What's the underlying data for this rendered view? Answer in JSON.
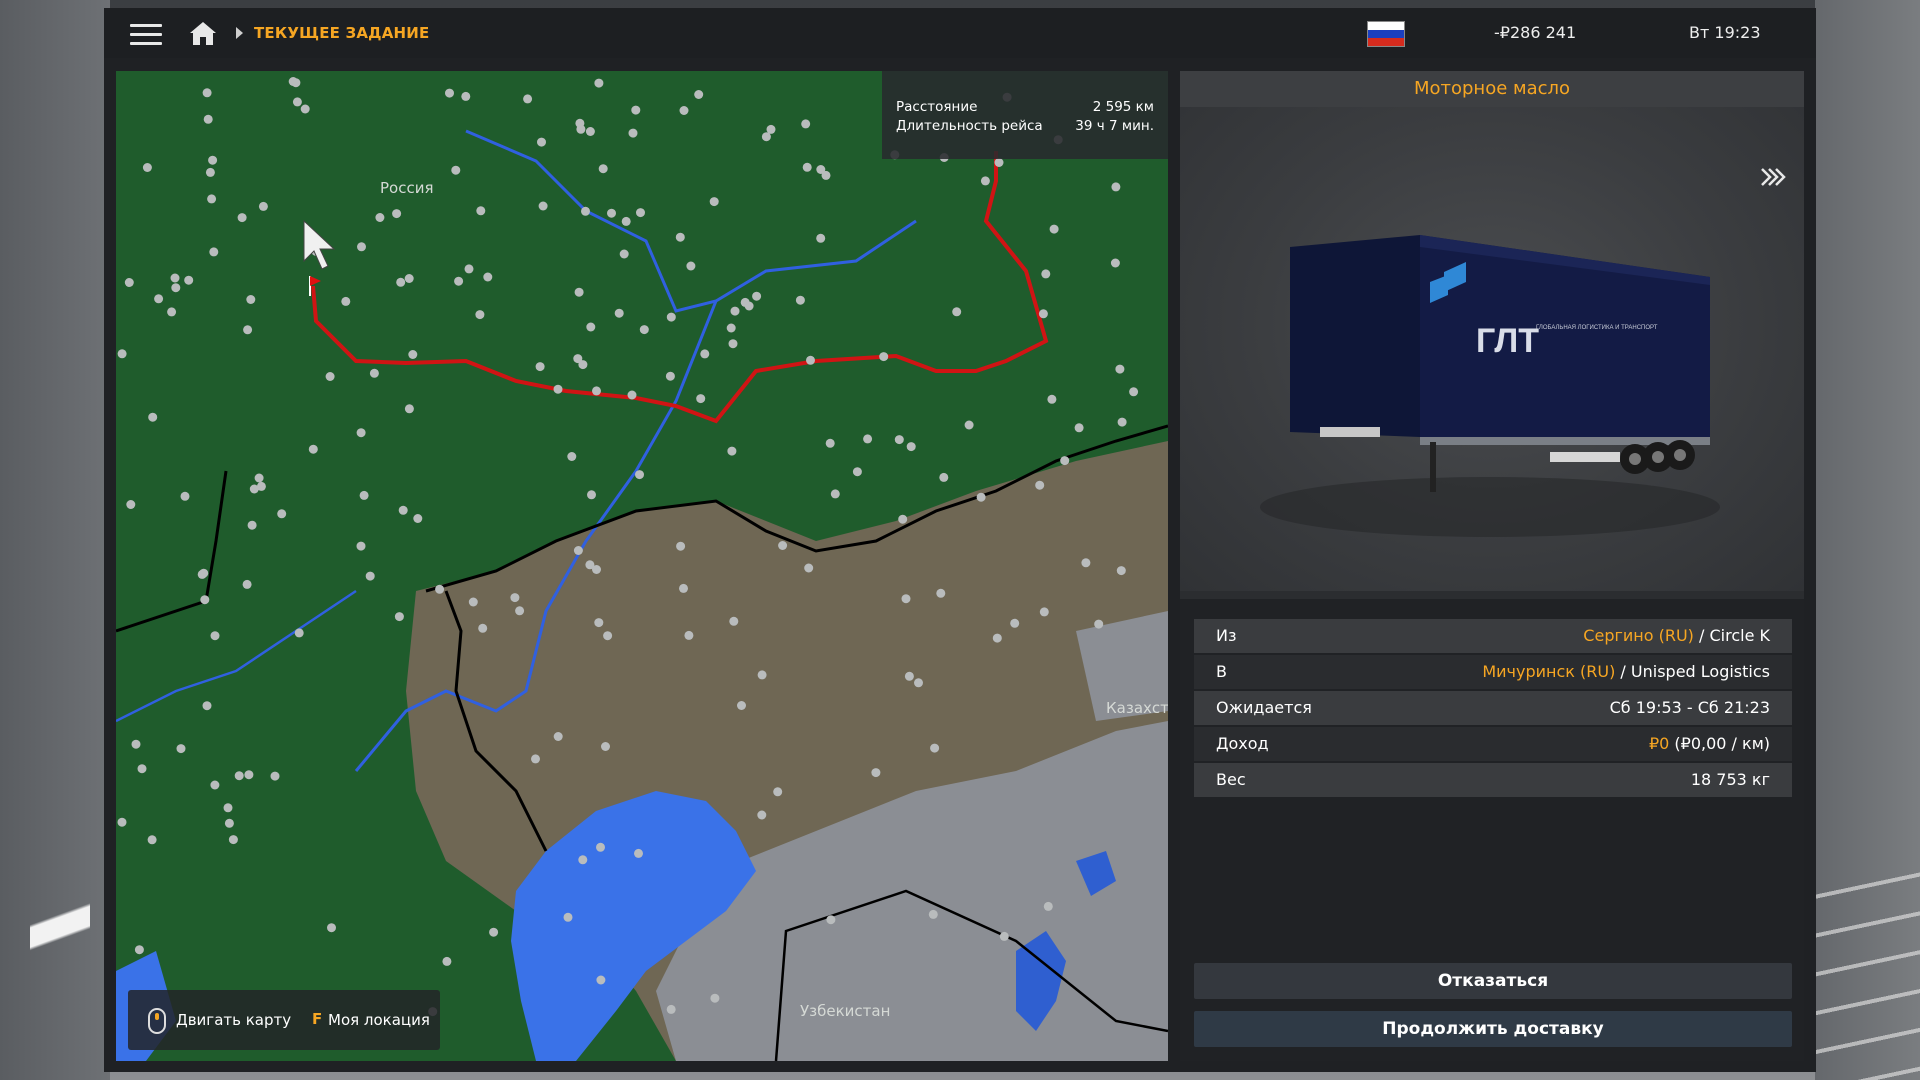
{
  "topbar": {
    "breadcrumb": "ТЕКУЩЕЕ ЗАДАНИЕ",
    "money": "-₽286 241",
    "clock": "Вт 19:23",
    "flag_colors": [
      "#ffffff",
      "#1c3fbf",
      "#d52b1e"
    ]
  },
  "map": {
    "info": {
      "distance_label": "Расстояние",
      "distance_value": "2 595 км",
      "duration_label": "Длительность рейса",
      "duration_value": "39 ч 7 мин."
    },
    "labels": {
      "russia": "Россия",
      "kazakhstan": "Казахст",
      "uzbekistan": "Узбекистан"
    },
    "controls": {
      "move_map": "Двигать карту",
      "my_location_key": "F",
      "my_location": "Моя локация"
    },
    "colors": {
      "forest": "#1f5c2c",
      "steppe": "#6f6754",
      "desert": "#8b8e94",
      "water": "#3a72e8",
      "route": "#d01414"
    }
  },
  "cargo": {
    "title": "Моторное масло",
    "trailer_brand": "ГЛТ",
    "trailer_tagline": "ГЛОБАЛЬНАЯ ЛОГИСТИКА И ТРАНСПОРТ"
  },
  "details": {
    "from_label": "Из",
    "from_city": "Сергино (RU)",
    "from_company": " / Circle K",
    "to_label": "В",
    "to_city": "Мичуринск (RU)",
    "to_company": " / Unisped Logistics",
    "expected_label": "Ожидается",
    "expected_value": "Сб 19:53 - Сб 21:23",
    "income_label": "Доход",
    "income_value": "₽0",
    "income_rate": " (₽0,00 / км)",
    "weight_label": "Вес",
    "weight_value": "18 753 кг"
  },
  "buttons": {
    "decline": "Отказаться",
    "continue": "Продолжить доставку"
  }
}
